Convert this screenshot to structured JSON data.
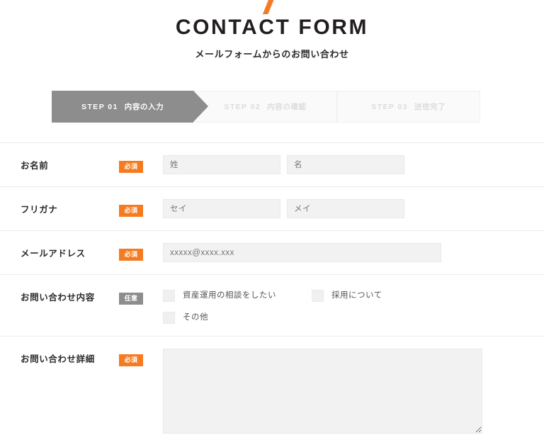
{
  "header": {
    "slash_icon": "orange-slash-accent",
    "title": "CONTACT FORM",
    "subtitle": "メールフォームからのお問い合わせ",
    "accent_color": "#f07c2a"
  },
  "steps": [
    {
      "num": "STEP 01",
      "label": "内容の入力",
      "state": "active"
    },
    {
      "num": "STEP 02",
      "label": "内容の確認",
      "state": "inactive"
    },
    {
      "num": "STEP 03",
      "label": "送信完了",
      "state": "inactive"
    }
  ],
  "badges": {
    "required": "必須",
    "optional": "任意",
    "required_color": "#f47b20",
    "optional_color": "#8d8d8d"
  },
  "rows": {
    "name": {
      "label": "お名前",
      "badge": "必須",
      "last_name_placeholder": "姓",
      "first_name_placeholder": "名"
    },
    "furigana": {
      "label": "フリガナ",
      "badge": "必須",
      "last_kana_placeholder": "セイ",
      "first_kana_placeholder": "メイ"
    },
    "email": {
      "label": "メールアドレス",
      "badge": "必須",
      "placeholder": "xxxxx@xxxx.xxx"
    },
    "inquiry_type": {
      "label": "お問い合わせ内容",
      "badge": "任意",
      "options": [
        "資産運用の相談をしたい",
        "採用について",
        "その他"
      ]
    },
    "detail": {
      "label": "お問い合わせ詳細",
      "badge": "必須",
      "value": ""
    }
  }
}
